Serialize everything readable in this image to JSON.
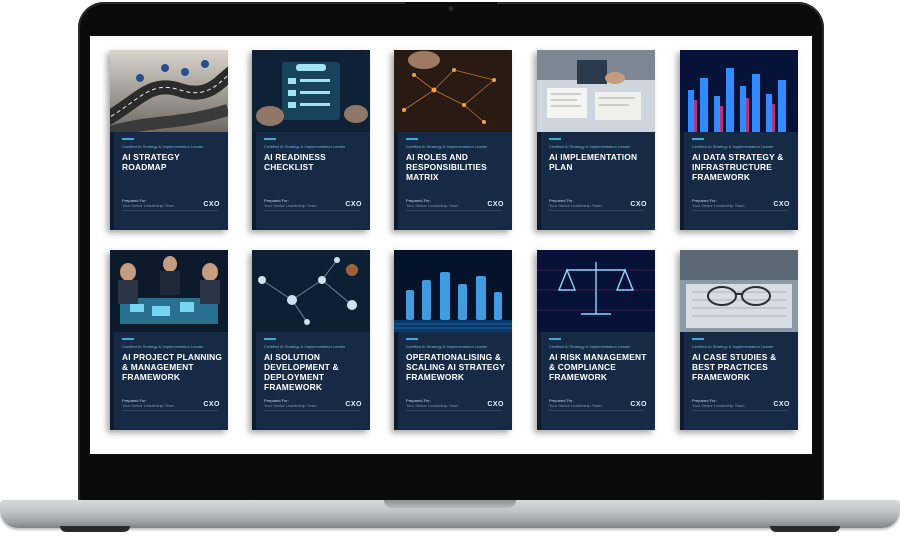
{
  "showcase": {
    "series_label": "Certified AI Strategy & Implementation Leader",
    "prepared_for": "Prepared For:",
    "prepared_team": "Your Senior Leadership Team",
    "brand": "CXO",
    "books": [
      {
        "title": "AI STRATEGY ROADMAP",
        "image": "winding-road-with-map-pins-photo"
      },
      {
        "title": "AI READINESS CHECKLIST",
        "image": "tablet-policies-checklist-photo"
      },
      {
        "title": "AI ROLES AND RESPONSIBILITIES MATRIX",
        "image": "network-of-figurines-photo"
      },
      {
        "title": "AI IMPLEMENTATION PLAN",
        "image": "business-planning-desk-photo"
      },
      {
        "title": "AI DATA STRATEGY & INFRASTRUCTURE FRAMEWORK",
        "image": "digital-data-city-photo"
      },
      {
        "title": "AI PROJECT PLANNING & MANAGEMENT FRAMEWORK",
        "image": "team-around-holographic-table-photo"
      },
      {
        "title": "AI SOLUTION DEVELOPMENT & DEPLOYMENT FRAMEWORK",
        "image": "molecular-network-photo"
      },
      {
        "title": "OPERATIONALISING & SCALING AI STRATEGY FRAMEWORK",
        "image": "glowing-chess-pieces-photo"
      },
      {
        "title": "AI RISK MANAGEMENT & COMPLIANCE FRAMEWORK",
        "image": "digital-scales-of-justice-photo"
      },
      {
        "title": "AI CASE STUDIES & BEST PRACTICES FRAMEWORK",
        "image": "glasses-on-documents-photo"
      }
    ]
  },
  "colors": {
    "cover_navy": "#172a45",
    "accent_blue": "#3fa9d6"
  }
}
